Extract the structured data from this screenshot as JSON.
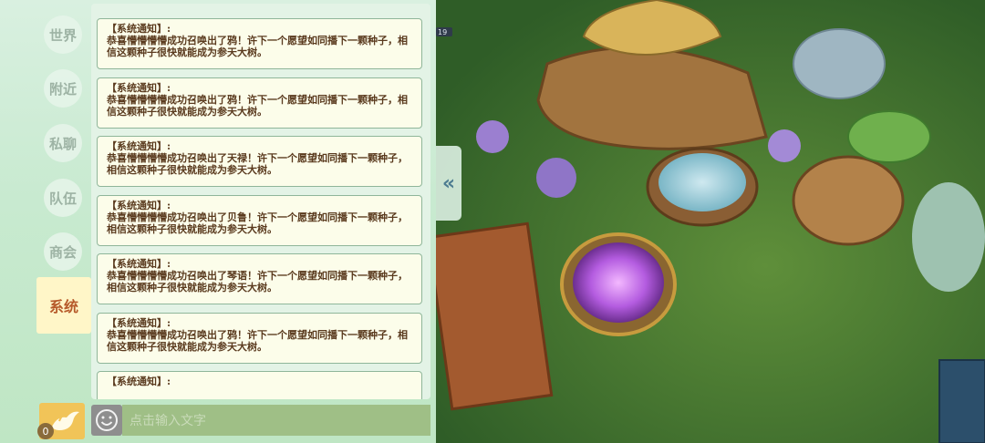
{
  "tabs": [
    {
      "label": "世界"
    },
    {
      "label": "附近"
    },
    {
      "label": "私聊"
    },
    {
      "label": "队伍"
    },
    {
      "label": "商会"
    },
    {
      "label": "系统",
      "active": true
    }
  ],
  "messages": [
    {
      "head": "【系统通知】:",
      "body": "恭喜懵懵懵懵成功召唤出了鸦！许下一个愿望如同播下一颗种子，相信这颗种子很快就能成为参天大树。"
    },
    {
      "head": "【系统通知】:",
      "body": "恭喜懵懵懵懵成功召唤出了鸦！许下一个愿望如同播下一颗种子，相信这颗种子很快就能成为参天大树。"
    },
    {
      "head": "【系统通知】:",
      "body": "恭喜懵懵懵懵成功召唤出了天禄！许下一个愿望如同播下一颗种子，相信这颗种子很快就能成为参天大树。"
    },
    {
      "head": "【系统通知】:",
      "body": "恭喜懵懵懵懵成功召唤出了贝鲁！许下一个愿望如同播下一颗种子，相信这颗种子很快就能成为参天大树。"
    },
    {
      "head": "【系统通知】:",
      "body": "恭喜懵懵懵懵成功召唤出了琴语！许下一个愿望如同播下一颗种子，相信这颗种子很快就能成为参天大树。"
    },
    {
      "head": "【系统通知】:",
      "body": "恭喜懵懵懵懵成功召唤出了鸦！许下一个愿望如同播下一颗种子，相信这颗种子很快就能成为参天大树。"
    },
    {
      "head": "【系统通知】:",
      "body": ""
    }
  ],
  "collapse": {
    "icon": "double-chevron-left-icon",
    "glyph": "«"
  },
  "bottom": {
    "bird_icon": "dove-icon",
    "bird_count": "0",
    "emoji_icon": "smiley-icon",
    "input_placeholder": "点击输入文字"
  },
  "scene": {
    "badge": "19"
  }
}
